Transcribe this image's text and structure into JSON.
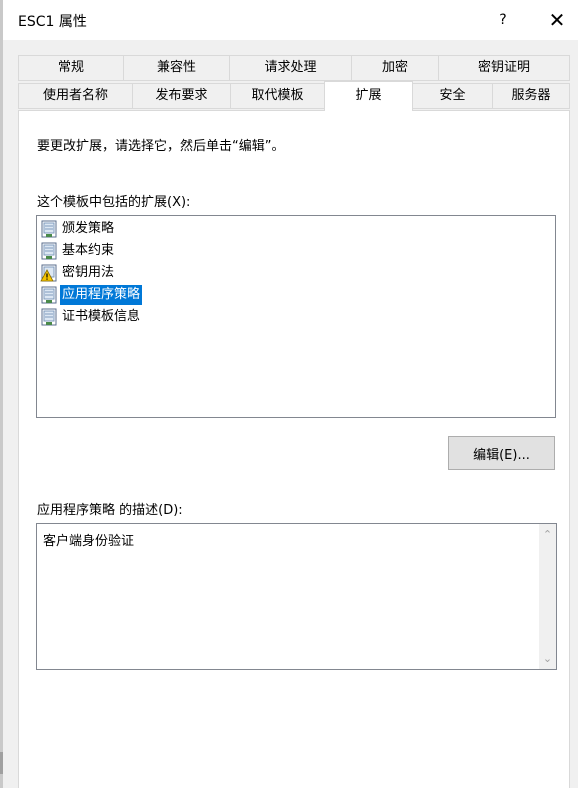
{
  "window": {
    "title": "ESC1 属性",
    "help_glyph": "?",
    "close_glyph": "✕"
  },
  "tabs_row1": [
    {
      "label": "常规"
    },
    {
      "label": "兼容性"
    },
    {
      "label": "请求处理"
    },
    {
      "label": "加密"
    },
    {
      "label": "密钥证明"
    }
  ],
  "tabs_row2": [
    {
      "label": "使用者名称"
    },
    {
      "label": "发布要求"
    },
    {
      "label": "取代模板"
    },
    {
      "label": "扩展",
      "active": true
    },
    {
      "label": "安全"
    },
    {
      "label": "服务器"
    }
  ],
  "panel": {
    "instruction": "要更改扩展，请选择它，然后单击“编辑”。",
    "list_label": "这个模板中包括的扩展(X):",
    "extensions": [
      {
        "label": "颁发策略",
        "icon": "certificate-icon"
      },
      {
        "label": "基本约束",
        "icon": "certificate-icon"
      },
      {
        "label": "密钥用法",
        "icon": "certificate-warning-icon"
      },
      {
        "label": "应用程序策略",
        "icon": "certificate-icon",
        "selected": true
      },
      {
        "label": "证书模板信息",
        "icon": "certificate-icon"
      }
    ],
    "edit_button": "编辑(E)...",
    "desc_label": "应用程序策略 的描述(D):",
    "description": "客户端身份验证",
    "scroll_up_glyph": "⌃",
    "scroll_down_glyph": "⌄"
  },
  "colors": {
    "selection": "#0078d7",
    "dialog_bg": "#f0f0f0"
  }
}
